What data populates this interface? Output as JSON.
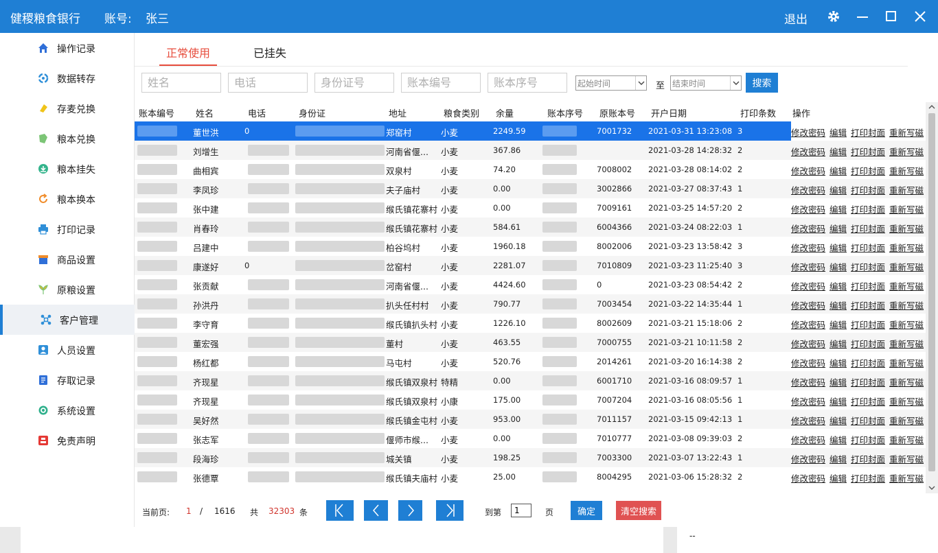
{
  "app": {
    "title": "健稷粮食银行",
    "account_label": "账号:",
    "account_name": "张三",
    "logout": "退出"
  },
  "sidebar": {
    "items": [
      {
        "label": "操作记录",
        "icon": "home-icon",
        "color": "#2f6fd8"
      },
      {
        "label": "数据转存",
        "icon": "data-transfer-icon",
        "color": "#2f8fd8"
      },
      {
        "label": "存麦兑换",
        "icon": "exchange-icon",
        "color": "#f0c419"
      },
      {
        "label": "粮本兑换",
        "icon": "book-exchange-icon",
        "color": "#7cc576"
      },
      {
        "label": "粮本挂失",
        "icon": "report-loss-icon",
        "color": "#34b48c"
      },
      {
        "label": "粮本换本",
        "icon": "refresh-icon",
        "color": "#f08c2a"
      },
      {
        "label": "打印记录",
        "icon": "printer-icon",
        "color": "#2f8fd8"
      },
      {
        "label": "商品设置",
        "icon": "shop-icon",
        "color": "#2f6fd8"
      },
      {
        "label": "原粮设置",
        "icon": "grain-icon",
        "color": "#e8b62c"
      },
      {
        "label": "客户管理",
        "icon": "customer-network-icon",
        "color": "#2f8fd8"
      },
      {
        "label": "人员设置",
        "icon": "person-icon",
        "color": "#2f8fd8"
      },
      {
        "label": "存取记录",
        "icon": "document-icon",
        "color": "#2f6fd8"
      },
      {
        "label": "系统设置",
        "icon": "settings-icon",
        "color": "#2fb08c"
      },
      {
        "label": "免责声明",
        "icon": "disclaimer-icon",
        "color": "#e53935"
      }
    ]
  },
  "tabs": [
    {
      "label": "正常使用"
    },
    {
      "label": "已挂失"
    }
  ],
  "search": {
    "name_placeholder": "姓名",
    "phone_placeholder": "电话",
    "id_placeholder": "身份证号",
    "book_no_placeholder": "账本编号",
    "book_seq_placeholder": "账本序号",
    "start_time": "起始时间",
    "to": "至",
    "end_time": "结束时间",
    "button": "搜索"
  },
  "table": {
    "headers": [
      "账本编号",
      "姓名",
      "电话",
      "身份证",
      "地址",
      "粮食类别",
      "余量",
      "账本序号",
      "原账本号",
      "开户日期",
      "打印条数",
      "操作"
    ],
    "ops": [
      "修改密码",
      "编辑",
      "打印封面",
      "重新写磁"
    ],
    "rows": [
      {
        "name": "董世洪",
        "phone": "0",
        "addr": "郑窑村",
        "type": "小麦",
        "bal": "2249.59",
        "orig": "7001732",
        "date": "2021-03-31 13:23:08",
        "prints": "3"
      },
      {
        "name": "刘增生",
        "phone": "",
        "addr": "河南省偃...",
        "type": "小麦",
        "bal": "367.86",
        "orig": "",
        "date": "2021-03-28 14:28:32",
        "prints": "2"
      },
      {
        "name": "曲相宾",
        "phone": "",
        "addr": "双泉村",
        "type": "小麦",
        "bal": "74.20",
        "orig": "7008002",
        "date": "2021-03-28 08:14:02",
        "prints": "2"
      },
      {
        "name": "李凤珍",
        "phone": "",
        "addr": "夫子庙村",
        "type": "小麦",
        "bal": "0.00",
        "orig": "3002866",
        "date": "2021-03-27 08:37:43",
        "prints": "1"
      },
      {
        "name": "张中建",
        "phone": "",
        "addr": "缑氏镇花寨村",
        "type": "小麦",
        "bal": "0.00",
        "orig": "7009161",
        "date": "2021-03-25 14:57:20",
        "prints": "2"
      },
      {
        "name": "肖春玲",
        "phone": "",
        "addr": "缑氏镇花寨村",
        "type": "小麦",
        "bal": "584.61",
        "orig": "6004366",
        "date": "2021-03-24 08:22:03",
        "prints": "1"
      },
      {
        "name": "吕建中",
        "phone": "",
        "addr": "柏谷坞村",
        "type": "小麦",
        "bal": "1960.18",
        "orig": "8002006",
        "date": "2021-03-23 13:58:42",
        "prints": "3"
      },
      {
        "name": "康遂好",
        "phone": "0",
        "addr": "岔窑村",
        "type": "小麦",
        "bal": "2281.07",
        "orig": "7010809",
        "date": "2021-03-23 11:25:40",
        "prints": "3"
      },
      {
        "name": "张贡献",
        "phone": "",
        "addr": "河南省偃...",
        "type": "小麦",
        "bal": "4424.60",
        "orig": "0",
        "date": "2021-03-23 08:54:42",
        "prints": "2"
      },
      {
        "name": "孙洪丹",
        "phone": "",
        "addr": "扒头任村村",
        "type": "小麦",
        "bal": "790.77",
        "orig": "7003454",
        "date": "2021-03-22 14:35:44",
        "prints": "1"
      },
      {
        "name": "李守育",
        "phone": "",
        "addr": "缑氏镇扒头村",
        "type": "小麦",
        "bal": "1226.10",
        "orig": "8002609",
        "date": "2021-03-21 15:18:06",
        "prints": "2"
      },
      {
        "name": "董宏强",
        "phone": "",
        "addr": "董村",
        "type": "小麦",
        "bal": "463.55",
        "orig": "7000755",
        "date": "2021-03-21 10:11:58",
        "prints": "2"
      },
      {
        "name": "杨红都",
        "phone": "",
        "addr": "马屯村",
        "type": "小麦",
        "bal": "520.76",
        "orig": "2014261",
        "date": "2021-03-20 16:14:38",
        "prints": "2"
      },
      {
        "name": "齐现星",
        "phone": "",
        "addr": "缑氏镇双泉村",
        "type": "特精",
        "bal": "0.00",
        "orig": "6001710",
        "date": "2021-03-16 08:09:57",
        "prints": "1"
      },
      {
        "name": "齐现星",
        "phone": "",
        "addr": "缑氏镇双泉村",
        "type": "小康",
        "bal": "175.00",
        "orig": "7007204",
        "date": "2021-03-16 08:05:56",
        "prints": "1"
      },
      {
        "name": "吴好然",
        "phone": "",
        "addr": "缑氏镇金屯村",
        "type": "小麦",
        "bal": "953.00",
        "orig": "7011157",
        "date": "2021-03-15 09:42:13",
        "prints": "1"
      },
      {
        "name": "张志军",
        "phone": "",
        "addr": "偃师市缑...",
        "type": "小麦",
        "bal": "0.00",
        "orig": "7010777",
        "date": "2021-03-08 09:39:03",
        "prints": "2"
      },
      {
        "name": "段海珍",
        "phone": "",
        "addr": "城关镇",
        "type": "小麦",
        "bal": "198.25",
        "orig": "7003300",
        "date": "2021-03-07 13:22:43",
        "prints": "1"
      },
      {
        "name": "张德覃",
        "phone": "",
        "addr": "缑氏镇夫庙村",
        "type": "小麦",
        "bal": "25.00",
        "orig": "8004295",
        "date": "2021-03-06 15:28:32",
        "prints": "2"
      }
    ]
  },
  "pager": {
    "current_label": "当前页:",
    "current": "1",
    "slash": "/",
    "total_pages": "1616",
    "total_label": "共",
    "total_count": "32303",
    "count_unit": "条",
    "goto_label": "到第",
    "goto_value": "1",
    "page_unit": "页",
    "ok": "确定",
    "clear": "清空搜索"
  },
  "bottom": {
    "text": "--"
  }
}
